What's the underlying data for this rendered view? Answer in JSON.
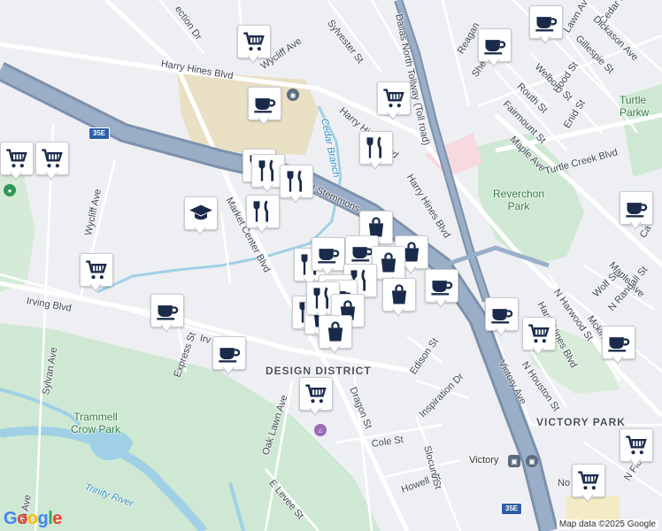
{
  "colors": {
    "land": "#eeeff2",
    "park": "#cfe8d3",
    "water": "#9fd0e6",
    "highway": "#8fa3bf",
    "highway_edge": "#7d91ad",
    "arterial": "#ffffff",
    "tan_block": "#e9dfc3",
    "pin_icon": "#1a2a4a"
  },
  "street_labels": [
    {
      "id": "sylvester",
      "text": "Sylvester St"
    },
    {
      "id": "dallas-north-tollway",
      "text": "Dallas North Tollway (Toll road)"
    },
    {
      "id": "lawn-av",
      "text": "Lawn Av"
    },
    {
      "id": "cedar-springs",
      "text": "Cedar Springs"
    },
    {
      "id": "dickason",
      "text": "Dickason Ave"
    },
    {
      "id": "gillespie",
      "text": "Gillespie St"
    },
    {
      "id": "reagan",
      "text": "Reagan"
    },
    {
      "id": "she",
      "text": "She"
    },
    {
      "id": "welborn",
      "text": "Welborn St"
    },
    {
      "id": "routh",
      "text": "Routh St"
    },
    {
      "id": "hood",
      "text": "Hood St"
    },
    {
      "id": "fairmount",
      "text": "Fairmount St"
    },
    {
      "id": "enid",
      "text": "Enid St"
    },
    {
      "id": "wycliff-top",
      "text": "Wycliff Ave"
    },
    {
      "id": "harry-hines-top",
      "text": "Harry Hines Blvd"
    },
    {
      "id": "harry-hines-mid",
      "text": "Harry Hines Blvd"
    },
    {
      "id": "harry-hines-right",
      "text": "Harry Hines Blvd"
    },
    {
      "id": "harry-hines-lower",
      "text": "Harry Hines Blvd"
    },
    {
      "id": "maple-top",
      "text": "Maple Ave"
    },
    {
      "id": "maple-right",
      "text": "Maple Ave"
    },
    {
      "id": "turtle-creek",
      "text": "Turtle Creek Blvd"
    },
    {
      "id": "stemmons",
      "text": "N Stemmons"
    },
    {
      "id": "market-center",
      "text": "Market Center Blvd"
    },
    {
      "id": "wycliff-left",
      "text": "Wycliff Ave"
    },
    {
      "id": "irving-blvd",
      "text": "Irving Blvd"
    },
    {
      "id": "irving-blvd-2",
      "text": "Irv"
    },
    {
      "id": "express",
      "text": "Express St"
    },
    {
      "id": "sylvan",
      "text": "Sylvan Ave"
    },
    {
      "id": "oak-lawn",
      "text": "Oak Lawn Ave"
    },
    {
      "id": "dragon",
      "text": "Dragon St"
    },
    {
      "id": "edison",
      "text": "Edison St"
    },
    {
      "id": "inspiration",
      "text": "Inspiration Dr"
    },
    {
      "id": "cole",
      "text": "Cole St"
    },
    {
      "id": "slocum",
      "text": "Slocum St"
    },
    {
      "id": "howell",
      "text": "Howell St"
    },
    {
      "id": "levee",
      "text": "E Levee St"
    },
    {
      "id": "victory-ave",
      "text": "Victory Ave"
    },
    {
      "id": "n-houston",
      "text": "N Houston St"
    },
    {
      "id": "n-harwood",
      "text": "N Harwood St"
    },
    {
      "id": "wolf",
      "text": "Wolf St"
    },
    {
      "id": "randall",
      "text": "N Randall St"
    },
    {
      "id": "mckinney",
      "text": "Mckinn"
    },
    {
      "id": "cedar-dr",
      "text": "ection Dr"
    },
    {
      "id": "ca",
      "text": "Ca"
    },
    {
      "id": "no",
      "text": "No"
    },
    {
      "id": "n-field",
      "text": "N Field St"
    },
    {
      "id": "jan",
      "text": "an Ave"
    }
  ],
  "area_labels": [
    {
      "id": "design-district",
      "text": "DESIGN DISTRICT"
    },
    {
      "id": "victory-park",
      "text": "VICTORY PARK"
    },
    {
      "id": "reverchon",
      "text": "Reverchon Park"
    },
    {
      "id": "trammell",
      "text": "Trammell Crow Park"
    },
    {
      "id": "turtle",
      "text": "Turtle Parkw"
    }
  ],
  "water_labels": [
    {
      "id": "cedar-branch",
      "text": "Cedar Branch"
    },
    {
      "id": "trinity",
      "text": "Trinity River"
    }
  ],
  "station": {
    "text": "Victory"
  },
  "shields": [
    {
      "text": "35E"
    },
    {
      "text": "35E"
    }
  ],
  "pins": [
    {
      "type": "shopping-cart"
    },
    {
      "type": "coffee-cup"
    },
    {
      "type": "coffee-cup"
    },
    {
      "type": "shopping-cart"
    },
    {
      "type": "coffee-cup"
    },
    {
      "type": "shopping-cart"
    },
    {
      "type": "restaurant"
    },
    {
      "type": "shopping-cart"
    },
    {
      "type": "shopping-cart"
    },
    {
      "type": "restaurant"
    },
    {
      "type": "restaurant"
    },
    {
      "type": "restaurant"
    },
    {
      "type": "graduation-cap"
    },
    {
      "type": "restaurant"
    },
    {
      "type": "shopping-cart"
    },
    {
      "type": "coffee-cup"
    },
    {
      "type": "shopping-bag"
    },
    {
      "type": "restaurant"
    },
    {
      "type": "coffee-cup"
    },
    {
      "type": "coffee-cup"
    },
    {
      "type": "shopping-bag"
    },
    {
      "type": "shopping-bag"
    },
    {
      "type": "restaurant"
    },
    {
      "type": "shopping-bag"
    },
    {
      "type": "restaurant"
    },
    {
      "type": "shopping-bag"
    },
    {
      "type": "coffee-cup"
    },
    {
      "type": "restaurant"
    },
    {
      "type": "shopping-bag"
    },
    {
      "type": "shopping-bag"
    },
    {
      "type": "shopping-bag"
    },
    {
      "type": "coffee-cup"
    },
    {
      "type": "coffee-cup"
    },
    {
      "type": "coffee-cup"
    },
    {
      "type": "shopping-cart"
    },
    {
      "type": "coffee-cup"
    },
    {
      "type": "coffee-cup"
    },
    {
      "type": "shopping-cart"
    },
    {
      "type": "shopping-cart"
    },
    {
      "type": "shopping-cart"
    },
    {
      "type": "coffee-cup"
    },
    {
      "type": "shopping-cart"
    }
  ],
  "google_logo": {
    "g1": "G",
    "o1": "o",
    "o2": "o",
    "g2": "g",
    "l": "l",
    "e": "e"
  },
  "attribution": "Map data ©2025 Google"
}
